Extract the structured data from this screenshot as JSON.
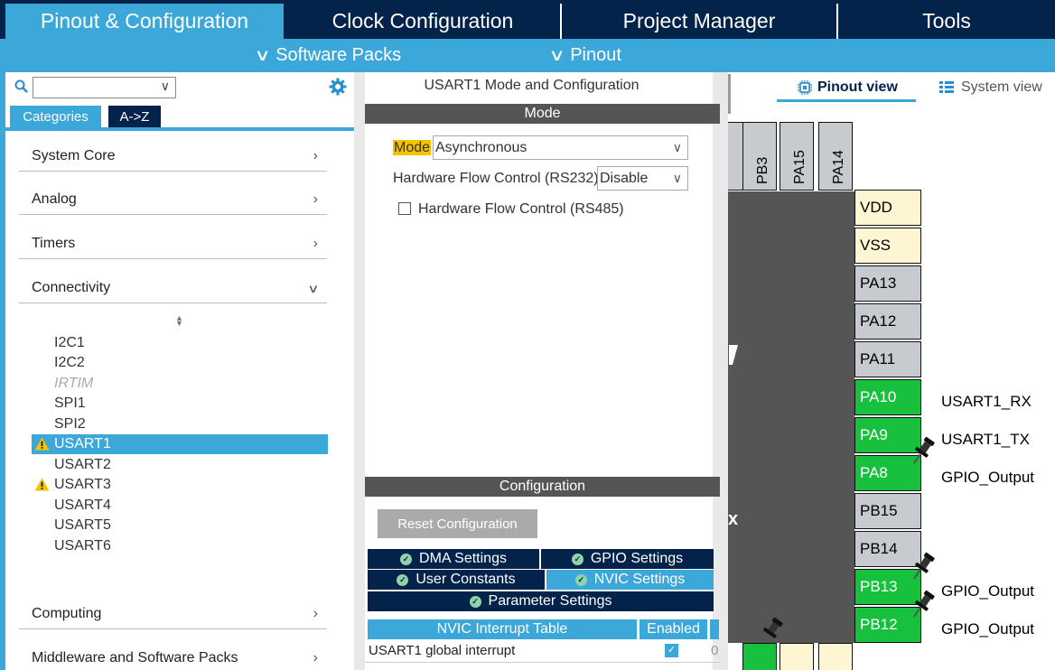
{
  "top_tabs": {
    "pinout_config": "Pinout & Configuration",
    "clock_config": "Clock Configuration",
    "project_manager": "Project Manager",
    "tools": "Tools"
  },
  "sub_menu": {
    "software_packs": "Software Packs",
    "pinout": "Pinout"
  },
  "left_panel": {
    "search_value": "",
    "tab_categories": "Categories",
    "tab_az": "A->Z",
    "categories": {
      "system_core": "System Core",
      "analog": "Analog",
      "timers": "Timers",
      "connectivity": "Connectivity",
      "computing": "Computing",
      "middleware": "Middleware and Software Packs"
    },
    "connectivity_items": [
      "I2C1",
      "I2C2",
      "IRTIM",
      "SPI1",
      "SPI2",
      "USART1",
      "USART2",
      "USART3",
      "USART4",
      "USART5",
      "USART6"
    ]
  },
  "middle_panel": {
    "title": "USART1 Mode and Configuration",
    "mode_header": "Mode",
    "mode_label": "Mode",
    "mode_value": "Asynchronous",
    "hw_flow_232_label": "Hardware Flow Control (RS232)",
    "hw_flow_232_value": "Disable",
    "hw_flow_485_label": "Hardware Flow Control (RS485)",
    "config_header": "Configuration",
    "reset_button": "Reset Configuration",
    "settings_tabs": {
      "dma": "DMA Settings",
      "gpio": "GPIO Settings",
      "user_constants": "User Constants",
      "nvic": "NVIC Settings",
      "parameter": "Parameter Settings"
    },
    "nvic_table": {
      "col_name": "NVIC Interrupt Table",
      "col_enabled": "Enabled",
      "row_name": "USART1 global interrupt",
      "row_extra": "0"
    }
  },
  "right_panel": {
    "pinout_view": "Pinout view",
    "system_view": "System view",
    "top_pins": [
      "PB3",
      "PA15",
      "PA14"
    ],
    "chip_fragment_label": "x",
    "right_pins": [
      "VDD",
      "VSS",
      "PA13",
      "PA12",
      "PA11",
      "PA10",
      "PA9",
      "PA8",
      "PB15",
      "PB14",
      "PB13",
      "PB12"
    ],
    "signals": {
      "pa10": "USART1_RX",
      "pa9": "USART1_TX",
      "pa8": "GPIO_Output",
      "pb13": "GPIO_Output",
      "pb12": "GPIO_Output"
    }
  },
  "colors": {
    "navy": "#03234b",
    "accent": "#3ca7d9",
    "pin_green": "#17c13d",
    "pin_gray": "#c7cbd0",
    "pin_power": "#fef5d2",
    "warn": "#f5c200"
  }
}
